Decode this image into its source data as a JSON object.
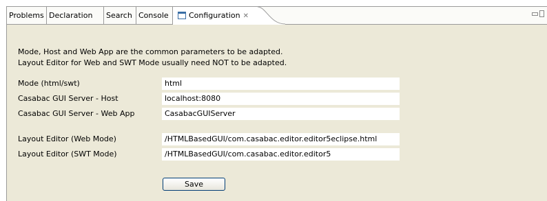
{
  "tabs": [
    {
      "label": "Problems"
    },
    {
      "label": "Declaration"
    },
    {
      "label": "Search"
    },
    {
      "label": "Console"
    },
    {
      "label": "Configuration",
      "active": true,
      "icon": "view-icon",
      "close": "✕"
    }
  ],
  "intro": {
    "line1": "Mode, Host and Web App are the common parameters to be adapted.",
    "line2": "Layout Editor for Web and SWT Mode usually need NOT to be adapted."
  },
  "fields": {
    "mode": {
      "label": "Mode (html/swt)",
      "value": "html"
    },
    "host": {
      "label": "Casabac GUI Server - Host",
      "value": "localhost:8080"
    },
    "webapp": {
      "label": "Casabac GUI Server - Web App",
      "value": "CasabacGUIServer"
    },
    "web_editor": {
      "label": "Layout Editor (Web Mode)",
      "value": "/HTMLBasedGUI/com.casabac.editor.editor5eclipse.html"
    },
    "swt_editor": {
      "label": "Layout Editor (SWT Mode)",
      "value": "/HTMLBasedGUI/com.casabac.editor.editor5"
    }
  },
  "save_label": "Save",
  "colors": {
    "panel_bg": "#ece9d8",
    "tab_bg": "#fbfbf8",
    "button_border": "#003c74"
  }
}
